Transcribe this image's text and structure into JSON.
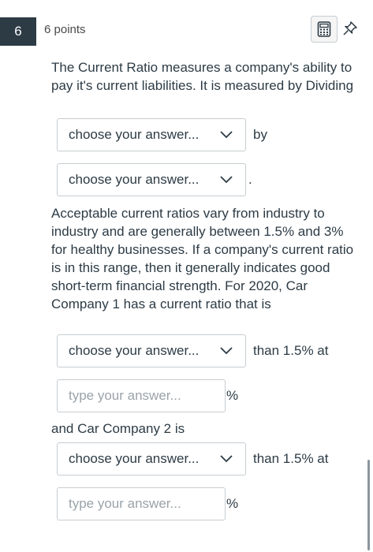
{
  "question": {
    "number": "6",
    "points": "6 points",
    "calculator_icon": "calculator-icon",
    "pin_icon": "pin-icon"
  },
  "paragraph1": "The Current Ratio measures a company's ability to pay it's current liabilities. It is measured by Dividing",
  "select1": {
    "value": "choose your answer...",
    "suffix": "by"
  },
  "select2": {
    "value": "choose your answer...",
    "suffix": "."
  },
  "paragraph2": "Acceptable current ratios vary from industry to industry and are generally between 1.5% and 3% for healthy businesses. If a company's current ratio is in this range, then it generally indicates good short-term financial strength. For 2020, Car Company 1 has a current ratio that is",
  "select3": {
    "value": "choose your answer...",
    "suffix": "than 1.5% at"
  },
  "input1": {
    "placeholder": "type your answer...",
    "value": "",
    "suffix": "%"
  },
  "line_company2": "and Car Company 2 is",
  "select4": {
    "value": "choose your answer...",
    "suffix": "than 1.5% at"
  },
  "input2": {
    "placeholder": "type your answer...",
    "value": "",
    "suffix": "%"
  }
}
